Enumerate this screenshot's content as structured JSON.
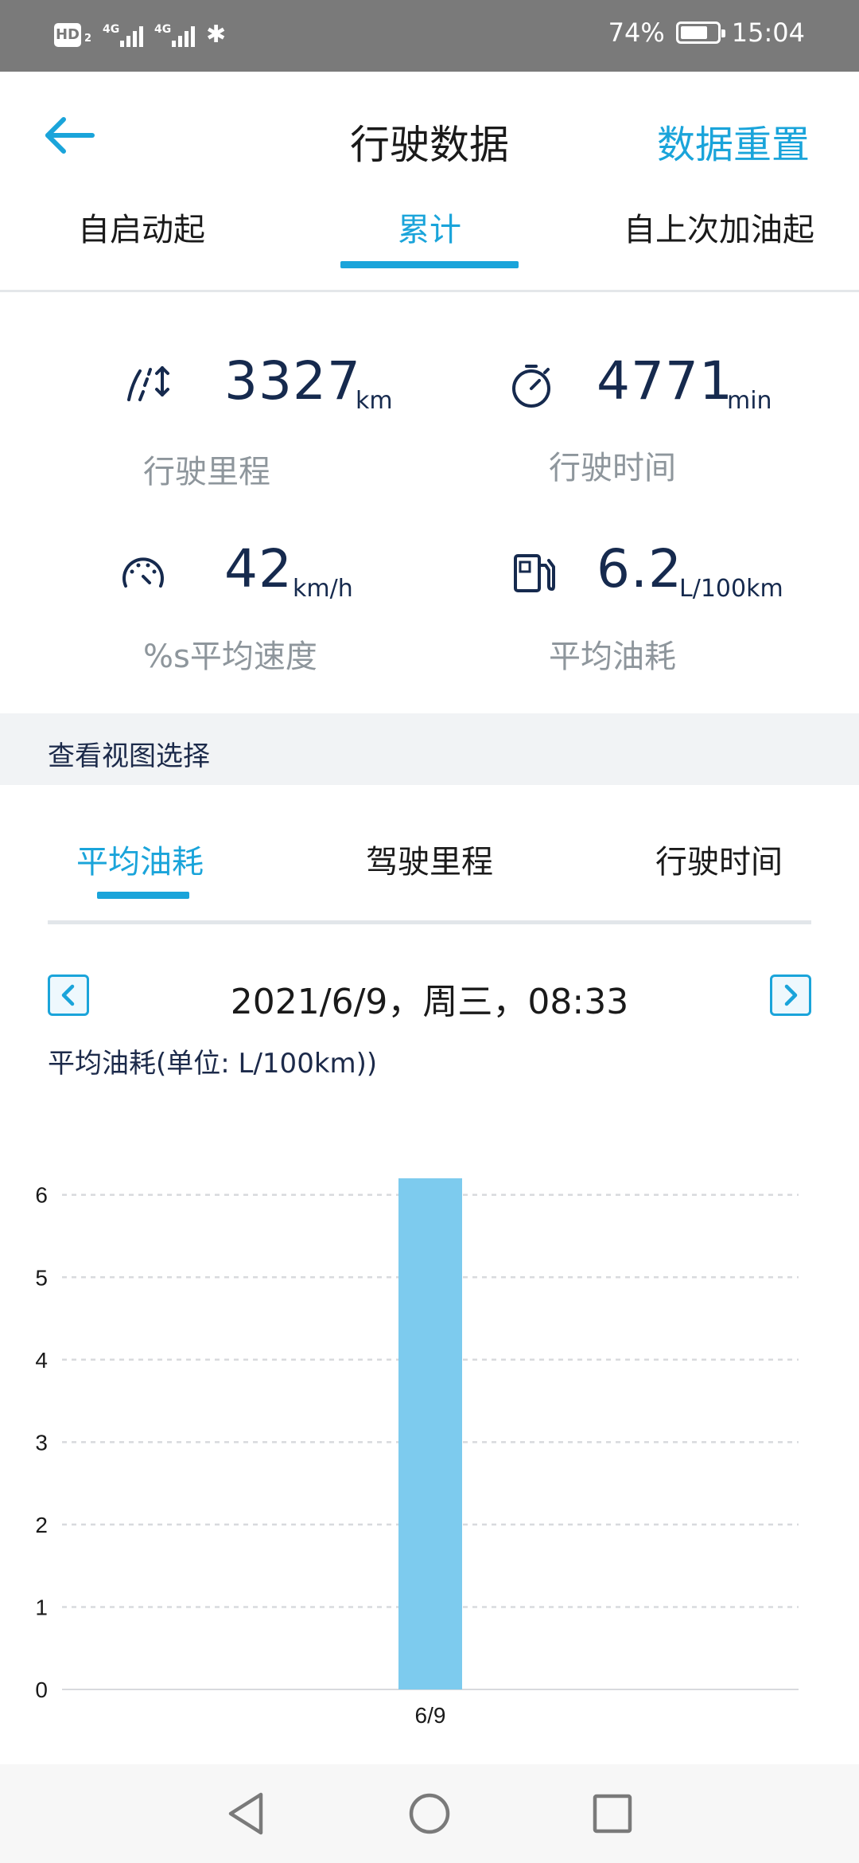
{
  "status_bar": {
    "hd_label": "HD",
    "hd_sub": "2",
    "signal1": "4G",
    "signal2": "4G",
    "battery_percent_text": "74%",
    "battery_level": 0.74,
    "time": "15:04"
  },
  "header": {
    "title": "行驶数据",
    "reset_label": "数据重置"
  },
  "top_tabs": [
    {
      "label": "自启动起"
    },
    {
      "label": "累计"
    },
    {
      "label": "自上次加油起"
    }
  ],
  "top_tabs_active": 1,
  "stats": {
    "distance": {
      "value": "3327",
      "unit": "km",
      "label": "行驶里程"
    },
    "time": {
      "value": "4771",
      "unit": "min",
      "label": "行驶时间"
    },
    "speed": {
      "value": "42",
      "unit": "km/h",
      "label": "%s平均速度"
    },
    "fuel": {
      "value": "6.2",
      "unit": "L/100km",
      "label": "平均油耗"
    }
  },
  "view_section": {
    "title": "查看视图选择",
    "tabs": [
      {
        "label": "平均油耗"
      },
      {
        "label": "驾驶里程"
      },
      {
        "label": "行驶时间"
      }
    ],
    "active": 0
  },
  "date_nav": {
    "label": "2021/6/9，周三，08:33"
  },
  "chart_title": "平均油耗(单位: L/100km))",
  "chart_data": {
    "type": "bar",
    "categories": [
      "6/9"
    ],
    "values": [
      6.2
    ],
    "ylim": [
      0,
      6.2
    ],
    "yticks": [
      0,
      1,
      2,
      3,
      4,
      5,
      6
    ],
    "grid": true,
    "bar_color": "#7dcbee",
    "title": "",
    "xlabel": "",
    "ylabel": ""
  },
  "colors": {
    "accent": "#1aa4da",
    "text_dark": "#162a4e",
    "text_muted": "#8e969c"
  }
}
